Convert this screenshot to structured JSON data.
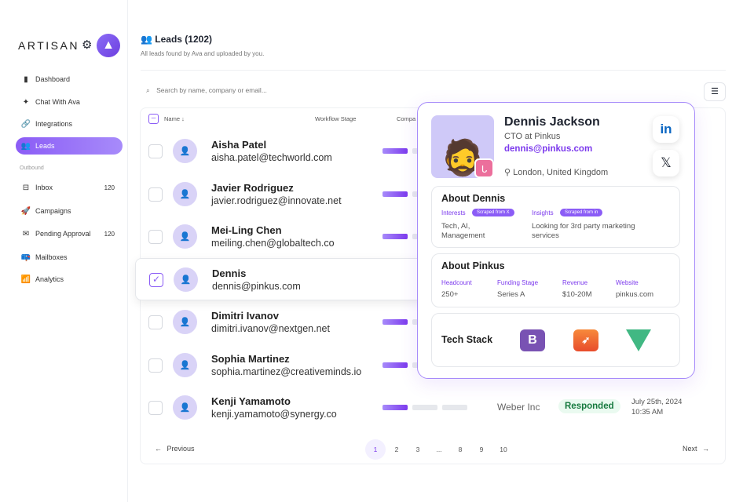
{
  "brand": {
    "name": "ARTISAN"
  },
  "sidebar": {
    "items": [
      {
        "label": "Dashboard",
        "icon": "dashboard-icon"
      },
      {
        "label": "Chat With Ava",
        "icon": "sparkle-icon"
      },
      {
        "label": "Integrations",
        "icon": "link-icon"
      },
      {
        "label": "Leads",
        "icon": "users-icon"
      }
    ],
    "section": "Outbound",
    "outbound": [
      {
        "label": "Inbox",
        "count": "120"
      },
      {
        "label": "Campaigns"
      },
      {
        "label": "Pending Approval",
        "count": "120"
      },
      {
        "label": "Mailboxes"
      },
      {
        "label": "Analytics"
      }
    ]
  },
  "header": {
    "title": "Leads (1202)",
    "subtitle": "All leads found by Ava and uploaded by you."
  },
  "search": {
    "placeholder": "Search by name, company or email..."
  },
  "table": {
    "columns": [
      "Name",
      "Workflow Stage",
      "Compa"
    ],
    "rows": [
      {
        "name": "Aisha Patel",
        "email": "aisha.patel@techworld.com"
      },
      {
        "name": "Javier Rodriguez",
        "email": "javier.rodriguez@innovate.net"
      },
      {
        "name": "Mei-Ling Chen",
        "email": "meiling.chen@globaltech.co"
      },
      {
        "name": "Dennis",
        "email": "dennis@pinkus.com"
      },
      {
        "name": "Dimitri Ivanov",
        "email": "dimitri.ivanov@nextgen.net"
      },
      {
        "name": "Sophia Martinez",
        "email": "sophia.martinez@creativeminds.io"
      },
      {
        "name": "Kenji Yamamoto",
        "email": "kenji.yamamoto@synergy.co",
        "company": "Weber Inc",
        "status": "Responded",
        "date": "July 25th, 2024",
        "time": "10:35 AM"
      }
    ]
  },
  "pagination": {
    "previous": "Previous",
    "next": "Next",
    "pages": [
      "1",
      "2",
      "3",
      "...",
      "8",
      "9",
      "10"
    ]
  },
  "profile": {
    "name": "Dennis Jackson",
    "role": "CTO at Pinkus",
    "email": "dennis@pinkus.com",
    "location": "London, United Kingdom",
    "about_title": "About Dennis",
    "interests_label": "Interests",
    "interests_chip": "Scraped from X",
    "interests": "Tech, AI, Management",
    "insights_label": "Insights",
    "insights_chip": "Scraped from in",
    "insights": "Looking for 3rd party marketing services",
    "company_title": "About Pinkus",
    "headcount_label": "Headcount",
    "headcount": "250+",
    "funding_label": "Funding Stage",
    "funding": "Series A",
    "revenue_label": "Revenue",
    "revenue": "$10-20M",
    "website_label": "Website",
    "website": "pinkus.com",
    "tech_title": "Tech Stack",
    "tech": [
      "B",
      "Swift",
      "Vue"
    ]
  },
  "colors": {
    "accent": "#7c3aed",
    "success": "#177a3f"
  }
}
